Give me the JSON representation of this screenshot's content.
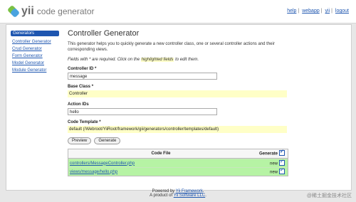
{
  "header": {
    "logo_text": "yii",
    "app_name": "code generator",
    "links": [
      "help",
      "webapp",
      "yii",
      "logout"
    ]
  },
  "sidebar": {
    "title": "Generators",
    "items": [
      "Controller Generator",
      "Crud Generator",
      "Form Generator",
      "Model Generator",
      "Module Generator"
    ]
  },
  "main": {
    "title": "Controller Generator",
    "description": "This generator helps you to quickly generate a new controller class, one or several controller actions and their corresponding views.",
    "note_prefix": "Fields with * are required. Click on the ",
    "note_highlight": "highlighted fields",
    "note_suffix": " to edit them.",
    "fields": {
      "controller_id": {
        "label": "Controller ID *",
        "value": "message"
      },
      "base_class": {
        "label": "Base Class *",
        "value": "Controller"
      },
      "action_ids": {
        "label": "Action IDs",
        "value": "hello"
      },
      "code_template": {
        "label": "Code Template *",
        "value": "default (/Webroot/YiiRoot/framework/gii/generators/controller/templates/default)"
      }
    },
    "buttons": {
      "preview": "Preview",
      "generate": "Generate"
    },
    "table": {
      "header_file": "Code File",
      "header_generate": "Generate",
      "rows": [
        {
          "file": "controllers/MessageController.php",
          "status": "new"
        },
        {
          "file": "views/message/hello.php",
          "status": "new"
        }
      ]
    }
  },
  "footer": {
    "line1_prefix": "Powered by ",
    "line1_link": "Yii Framework",
    "line1_suffix": ".",
    "line2_prefix": "A product of ",
    "line2_link": "Yii Software LLC",
    "line2_suffix": "."
  },
  "watermark": "@稀土掘金技术社区"
}
